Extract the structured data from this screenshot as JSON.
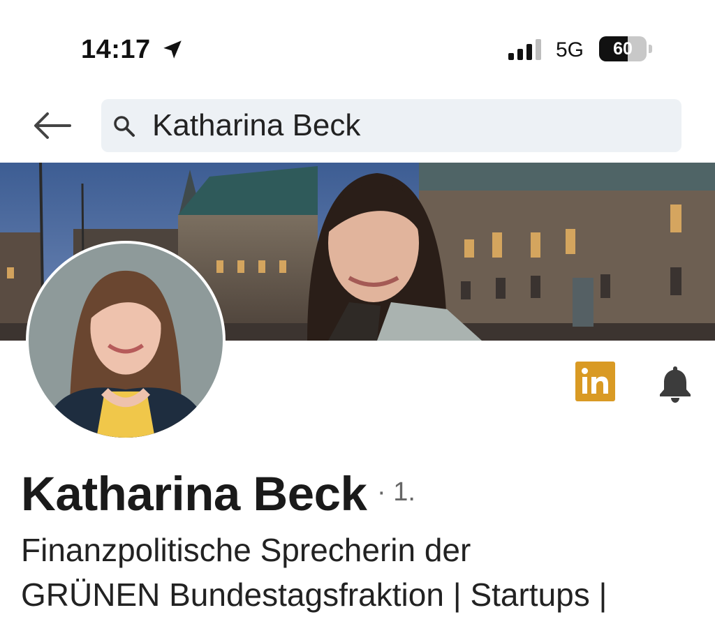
{
  "status_bar": {
    "time": "14:17",
    "location_icon": "location-arrow-icon",
    "signal_icon": "cellular-signal-icon",
    "network": "5G",
    "battery_percent": "60",
    "battery_level": 0.6
  },
  "header": {
    "back_icon": "back-arrow-icon",
    "search_icon": "search-icon",
    "search_query": "Katharina Beck"
  },
  "profile": {
    "name": "Katharina Beck",
    "degree": "· 1.",
    "headline_line1": "Finanzpolitische Sprecherin der",
    "headline_line2": "GRÜNEN Bundestagsfraktion | Startups |",
    "linkedin_badge": "in",
    "bell_icon": "bell-icon"
  },
  "colors": {
    "linkedin_badge": "#d99a24",
    "search_background": "#edf1f5",
    "text_primary": "#1a1a1a"
  }
}
